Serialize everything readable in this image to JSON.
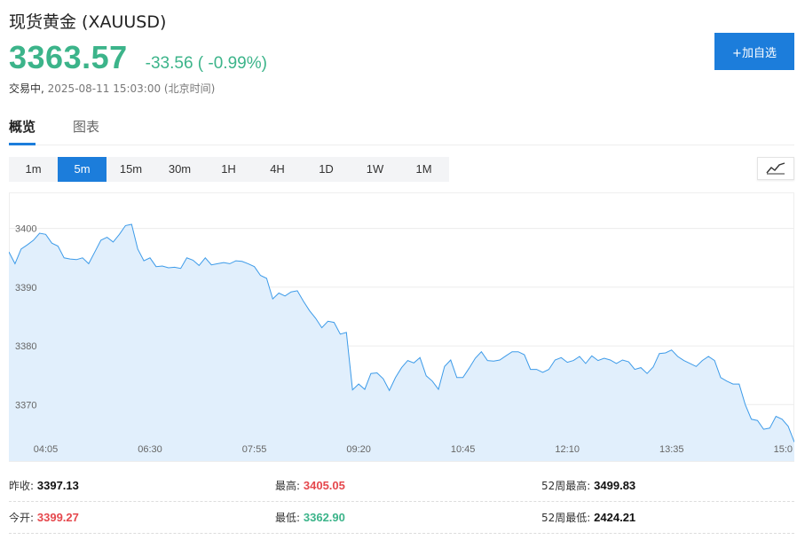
{
  "header": {
    "title": "现货黄金  (XAUUSD)",
    "price": "3363.57",
    "change": "-33.56 ( -0.99%)",
    "status_label": "交易中,",
    "status_time": "2025-08-11 15:03:00 (北京时间)",
    "add_button": "+加自选"
  },
  "tabs": [
    {
      "label": "概览",
      "active": true
    },
    {
      "label": "图表",
      "active": false
    }
  ],
  "intervals": [
    {
      "label": "1m",
      "active": false
    },
    {
      "label": "5m",
      "active": true
    },
    {
      "label": "15m",
      "active": false
    },
    {
      "label": "30m",
      "active": false
    },
    {
      "label": "1H",
      "active": false
    },
    {
      "label": "4H",
      "active": false
    },
    {
      "label": "1D",
      "active": false
    },
    {
      "label": "1W",
      "active": false
    },
    {
      "label": "1M",
      "active": false
    }
  ],
  "chart_type_icon": "line-chart-icon",
  "colors": {
    "up": "#e5484d",
    "down": "#3cb48a",
    "accent": "#1c7ddb",
    "line": "#3d9be9",
    "fill": "#e1effc"
  },
  "chart_data": {
    "type": "area",
    "title": "",
    "xlabel": "",
    "ylabel": "",
    "ylim": [
      3364,
      3404
    ],
    "yticks": [
      "3400",
      "3390",
      "3380",
      "3370"
    ],
    "ytick_values": [
      3400,
      3390,
      3380,
      3370
    ],
    "xticks": [
      "04:05",
      "06:30",
      "07:55",
      "09:20",
      "10:45",
      "12:10",
      "13:35",
      "15:0"
    ],
    "xtick_index": [
      6,
      23,
      40,
      57,
      74,
      91,
      108,
      125
    ],
    "grid": true,
    "values": [
      3396.0,
      3394.0,
      3396.5,
      3397.2,
      3398.0,
      3399.2,
      3399.0,
      3397.5,
      3397.0,
      3395.0,
      3394.8,
      3394.7,
      3395.0,
      3394.0,
      3396.0,
      3398.0,
      3398.5,
      3397.7,
      3399.0,
      3400.5,
      3400.7,
      3396.5,
      3394.5,
      3395.0,
      3393.5,
      3393.6,
      3393.3,
      3393.4,
      3393.2,
      3395.0,
      3394.6,
      3393.7,
      3395.0,
      3393.8,
      3394.0,
      3394.2,
      3394.0,
      3394.5,
      3394.4,
      3394.0,
      3393.5,
      3392.0,
      3391.5,
      3388.0,
      3389.0,
      3388.5,
      3389.2,
      3389.4,
      3387.6,
      3386.0,
      3384.7,
      3383.1,
      3384.2,
      3384.0,
      3382.0,
      3382.3,
      3372.5,
      3373.5,
      3372.6,
      3375.3,
      3375.4,
      3374.4,
      3372.4,
      3374.6,
      3376.3,
      3377.5,
      3377.1,
      3378.0,
      3374.9,
      3374.0,
      3372.6,
      3376.5,
      3377.6,
      3374.6,
      3374.6,
      3376.2,
      3377.9,
      3379.0,
      3377.5,
      3377.4,
      3377.6,
      3378.3,
      3379.0,
      3379.0,
      3378.5,
      3376.0,
      3376.0,
      3375.5,
      3376.0,
      3377.6,
      3378.0,
      3377.2,
      3377.5,
      3378.2,
      3377.0,
      3378.3,
      3377.5,
      3377.9,
      3377.6,
      3377.0,
      3377.6,
      3377.3,
      3376.0,
      3376.3,
      3375.3,
      3376.4,
      3378.7,
      3378.8,
      3379.3,
      3378.2,
      3377.5,
      3377.0,
      3376.5,
      3377.5,
      3378.2,
      3377.5,
      3374.6,
      3374.0,
      3373.5,
      3373.5,
      3370.0,
      3367.5,
      3367.3,
      3365.8,
      3366.0,
      3368.0,
      3367.5,
      3366.3,
      3363.6
    ]
  },
  "stats": [
    [
      {
        "label": "昨收:",
        "value": "3397.13",
        "tone": "black"
      },
      {
        "label": "最高:",
        "value": "3405.05",
        "tone": "red"
      },
      {
        "label": "52周最高:",
        "value": "3499.83",
        "tone": "black"
      }
    ],
    [
      {
        "label": "今开:",
        "value": "3399.27",
        "tone": "red"
      },
      {
        "label": "最低:",
        "value": "3362.90",
        "tone": "green"
      },
      {
        "label": "52周最低:",
        "value": "2424.21",
        "tone": "black"
      }
    ]
  ]
}
